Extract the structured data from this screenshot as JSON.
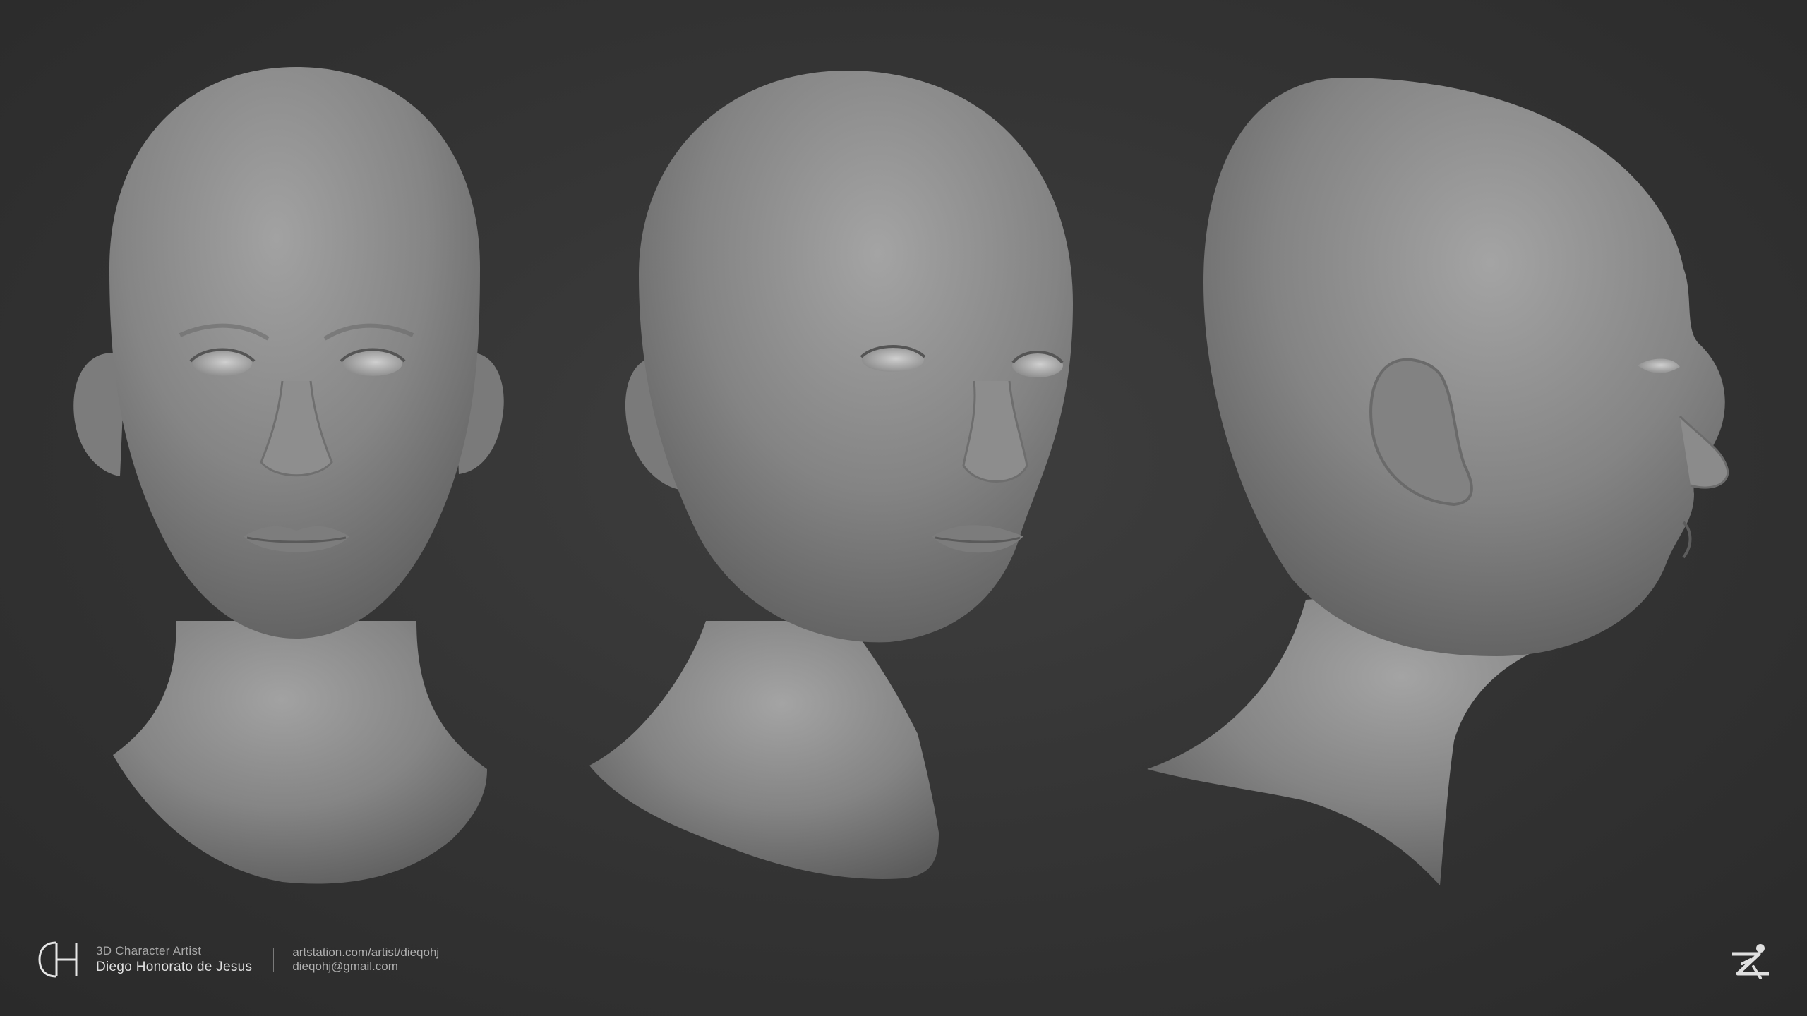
{
  "artist": {
    "initials": "DH",
    "role": "3D Character Artist",
    "name": "Diego Honorato de Jesus"
  },
  "contact": {
    "website": "artstation.com/artist/dieqohj",
    "email": "dieqohj@gmail.com"
  },
  "views": [
    {
      "id": "front",
      "icon": "head-front-view"
    },
    {
      "id": "three-quarter",
      "icon": "head-three-quarter-view"
    },
    {
      "id": "profile",
      "icon": "head-side-profile-view"
    }
  ],
  "icons": {
    "logo": "dh-monogram-logo",
    "software": "zbrush-logo-icon"
  },
  "colors": {
    "background": "#353535",
    "clay": "#8a8a8a",
    "text": "#d8d8d8"
  }
}
